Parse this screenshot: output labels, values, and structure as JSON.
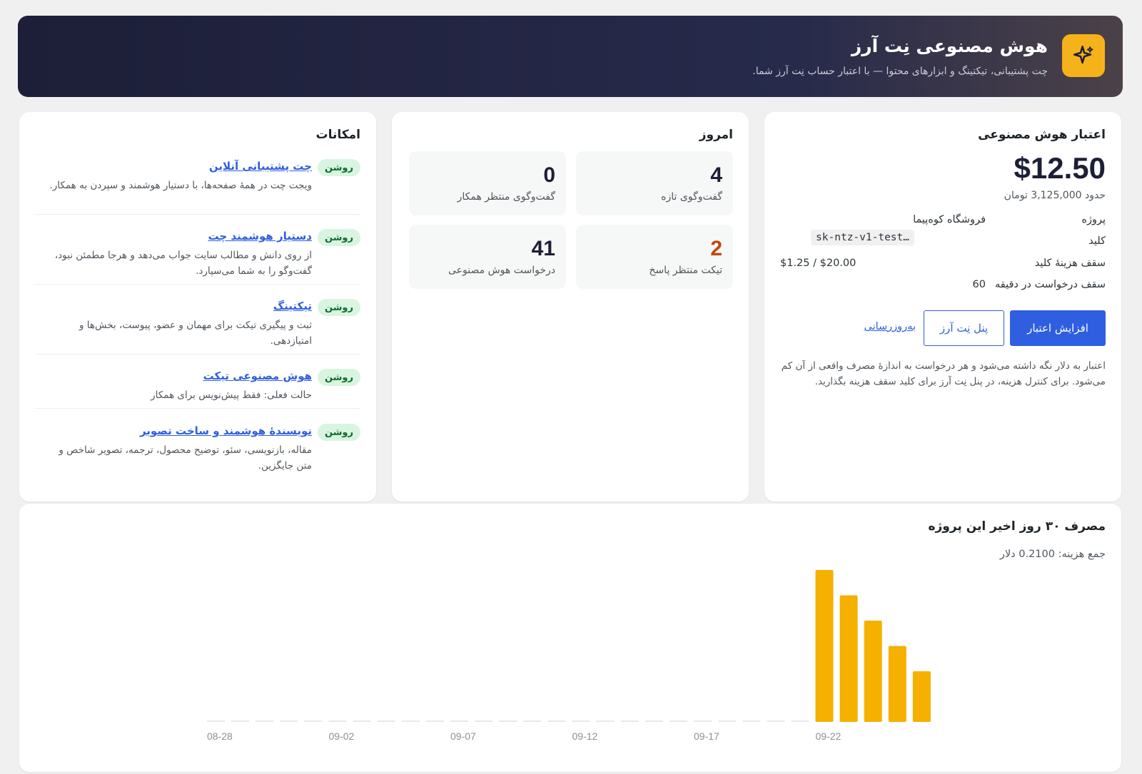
{
  "header": {
    "title": "هوش مصنوعی نِت آرز",
    "subtitle": "چت پشتیبانی، تیکتینگ و ابزارهای محتوا — با اعتبار حساب نِت آرز شما.",
    "logo_icon": "sparkle-icon"
  },
  "credit": {
    "title": "اعتبار هوش مصنوعی",
    "amount": "$12.50",
    "toman": "حدود 3,125,000 تومان",
    "project_label": "پروژه",
    "project_value": "فروشگاه کوه‌پیما",
    "key_label": "کلید",
    "key_value": "sk-ntz-v1-test…",
    "cap_label": "سقف هزینهٔ کلید",
    "cap_value": "$1.25 / $20.00",
    "rate_label": "سقف درخواست در دقیقه",
    "rate_value": "60",
    "btn_increase": "افزایش اعتبار",
    "btn_panel": "پنل نِت آرز",
    "link_refresh": "به‌روزرسانی",
    "note": "اعتبار به دلار نگه داشته می‌شود و هر درخواست به اندازهٔ مصرف واقعی از آن کم می‌شود. برای کنترل هزینه، در پنل نِت آرز برای کلید سقف هزینه بگذارید."
  },
  "today": {
    "title": "امروز",
    "stats": [
      {
        "value": "4",
        "label": "گفت‌وگوی تازه"
      },
      {
        "value": "0",
        "label": "گفت‌وگوی منتظر همکار"
      },
      {
        "value": "2",
        "label": "تیکت منتظر پاسخ"
      },
      {
        "value": "41",
        "label": "درخواست هوش مصنوعی"
      }
    ]
  },
  "features": {
    "title": "امکانات",
    "items": [
      {
        "badge": "روشن",
        "name": "چت پشتیبانی آنلاین",
        "desc": "ویجت چت در همهٔ صفحه‌ها، با دستیار هوشمند و سپردن به همکار."
      },
      {
        "badge": "روشن",
        "name": "دستیار هوشمند چت",
        "desc": "از روی دانش و مطالب سایت جواب می‌دهد و هرجا مطمئن نبود، گفت‌وگو را به شما می‌سپارد."
      },
      {
        "badge": "روشن",
        "name": "تیکتینگ",
        "desc": "ثبت و پیگیری تیکت برای مهمان و عضو، پیوست، بخش‌ها و امتیازدهی."
      },
      {
        "badge": "روشن",
        "name": "هوش مصنوعی تیکت",
        "desc": "حالت فعلی: فقط پیش‌نویس برای همکار"
      },
      {
        "badge": "روشن",
        "name": "نویسندهٔ هوشمند و ساخت تصویر",
        "desc": "مقاله، بازنویسی، سئو، توضیح محصول، ترجمه، تصویر شاخص و متن جایگزین."
      }
    ]
  },
  "usage": {
    "title": "مصرف ۳۰ روز اخیر این پروژه",
    "total": "جمع هزینه: 0.2100 دلار"
  },
  "chart_data": {
    "type": "bar",
    "categories": [
      "08-28",
      "08-29",
      "08-30",
      "08-31",
      "09-01",
      "09-02",
      "09-03",
      "09-04",
      "09-05",
      "09-06",
      "09-07",
      "09-08",
      "09-09",
      "09-10",
      "09-11",
      "09-12",
      "09-13",
      "09-14",
      "09-15",
      "09-16",
      "09-17",
      "09-18",
      "09-19",
      "09-20",
      "09-21",
      "09-22",
      "09-23",
      "09-24",
      "09-25",
      "09-26"
    ],
    "tick_labels": [
      "08-28",
      "09-02",
      "09-07",
      "09-12",
      "09-17",
      "09-22"
    ],
    "values": [
      0,
      0,
      0,
      0,
      0,
      0,
      0,
      0,
      0,
      0,
      0,
      0,
      0,
      0,
      0,
      0,
      0,
      0,
      0,
      0,
      0,
      0,
      0,
      0,
      0,
      0.06,
      0.05,
      0.04,
      0.03,
      0.02
    ],
    "color": "#f5b000",
    "empty_color": "#e5e7eb",
    "ylim": [
      0,
      0.06
    ]
  }
}
